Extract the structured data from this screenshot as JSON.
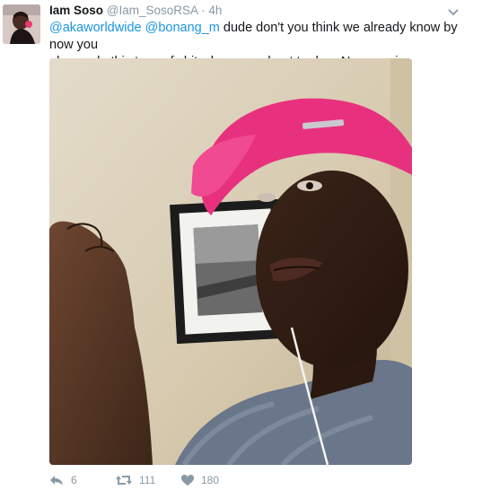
{
  "tweet": {
    "author_name": "Iam Soso",
    "author_handle": "@Iam_SosoRSA",
    "separator": "·",
    "timestamp": "4h",
    "mention_1": "@akaworldwide",
    "mention_2": "@bonang_m",
    "body_line_1": " dude don't you think we already know by now you",
    "body_line_2": "always do this type of shit when you about to drop New music",
    "reply_count": "6",
    "retweet_count": "111",
    "like_count": "180"
  },
  "icons": {
    "caret": "chevron-down-icon",
    "reply": "reply-icon",
    "retweet": "retweet-icon",
    "like": "heart-icon"
  },
  "colors": {
    "link": "#1b95e0",
    "meta": "#8899a6",
    "text": "#14171a"
  }
}
